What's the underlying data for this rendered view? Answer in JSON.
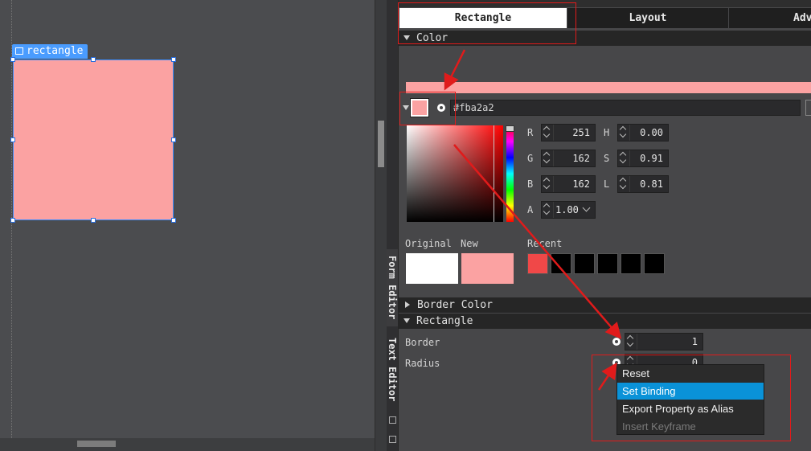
{
  "canvas": {
    "item_label": "rectangle",
    "item_fill": "#fba2a2",
    "selection_color": "#3b8cff"
  },
  "side_tabs": {
    "form_editor": "Form Editor",
    "text_editor": "Text Editor"
  },
  "tabs": [
    {
      "label": "Rectangle",
      "active": true
    },
    {
      "label": "Layout",
      "active": false
    },
    {
      "label": "Adva",
      "active": false
    }
  ],
  "color_section": {
    "title": "Color",
    "hex_value": "#fba2a2",
    "current_color": "#fba2a2",
    "rgb": {
      "r_label": "R",
      "r": "251",
      "g_label": "G",
      "g": "162",
      "b_label": "B",
      "b": "162"
    },
    "hsl": {
      "h_label": "H",
      "h": "0.00",
      "s_label": "S",
      "s": "0.91",
      "l_label": "L",
      "l": "0.81"
    },
    "alpha": {
      "label": "A",
      "value": "1.00"
    },
    "original_label": "Original",
    "new_label": "New",
    "recent_label": "Recent",
    "original_color": "#ffffff",
    "new_color": "#fba2a2",
    "recent_colors": [
      "#f04848",
      "#000000",
      "#000000",
      "#000000",
      "#000000",
      "#000000"
    ]
  },
  "border_color_section": {
    "title": "Border Color"
  },
  "rectangle_section": {
    "title": "Rectangle",
    "border_label": "Border",
    "border_value": "1",
    "radius_label": "Radius",
    "radius_value": "0"
  },
  "context_menu": {
    "items": [
      {
        "label": "Reset",
        "state": "normal"
      },
      {
        "label": "Set Binding",
        "state": "highlighted"
      },
      {
        "label": "Export Property as Alias",
        "state": "normal"
      },
      {
        "label": "Insert Keyframe",
        "state": "disabled"
      }
    ]
  },
  "annotation_color": "#e01b1b"
}
